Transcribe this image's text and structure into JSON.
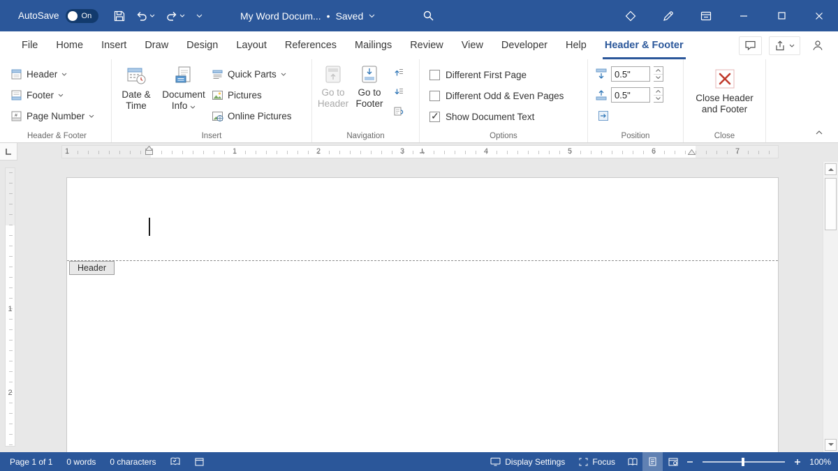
{
  "titlebar": {
    "autosave_label": "AutoSave",
    "autosave_state": "On",
    "doc_title": "My Word Docum...",
    "doc_status_separator": "•",
    "doc_status": "Saved"
  },
  "tabs": {
    "items": [
      {
        "label": "File"
      },
      {
        "label": "Home"
      },
      {
        "label": "Insert"
      },
      {
        "label": "Draw"
      },
      {
        "label": "Design"
      },
      {
        "label": "Layout"
      },
      {
        "label": "References"
      },
      {
        "label": "Mailings"
      },
      {
        "label": "Review"
      },
      {
        "label": "View"
      },
      {
        "label": "Developer"
      },
      {
        "label": "Help"
      },
      {
        "label": "Header & Footer"
      }
    ],
    "active": "Header & Footer"
  },
  "ribbon": {
    "header_footer_group": {
      "label": "Header & Footer",
      "header": "Header",
      "footer": "Footer",
      "page_number": "Page Number"
    },
    "insert_group": {
      "label": "Insert",
      "date_time": "Date & Time",
      "document_info": "Document Info",
      "quick_parts": "Quick Parts",
      "pictures": "Pictures",
      "online_pictures": "Online Pictures"
    },
    "navigation_group": {
      "label": "Navigation",
      "go_to_header": "Go to Header",
      "go_to_footer": "Go to Footer"
    },
    "options_group": {
      "label": "Options",
      "checkboxes": [
        {
          "label": "Different First Page",
          "checked": false
        },
        {
          "label": "Different Odd & Even Pages",
          "checked": false
        },
        {
          "label": "Show Document Text",
          "checked": true
        }
      ]
    },
    "position_group": {
      "label": "Position",
      "header_from_top": "0.5\"",
      "footer_from_bottom": "0.5\""
    },
    "close_group": {
      "label": "Close",
      "close_button": "Close Header and Footer"
    }
  },
  "ruler": {
    "horizontal_numbers": [
      "1",
      "1",
      "2",
      "3",
      "4",
      "5",
      "6",
      "7"
    ],
    "vertical_numbers": [
      "1",
      "2"
    ]
  },
  "document": {
    "header_tag": "Header"
  },
  "statusbar": {
    "page_info": "Page 1 of 1",
    "word_count": "0 words",
    "char_count": "0 characters",
    "display_settings": "Display Settings",
    "focus": "Focus",
    "zoom_level": "100%"
  },
  "colors": {
    "titlebar_bg": "#2b579a",
    "accent": "#2b579a",
    "close_x_red": "#c0392b"
  }
}
